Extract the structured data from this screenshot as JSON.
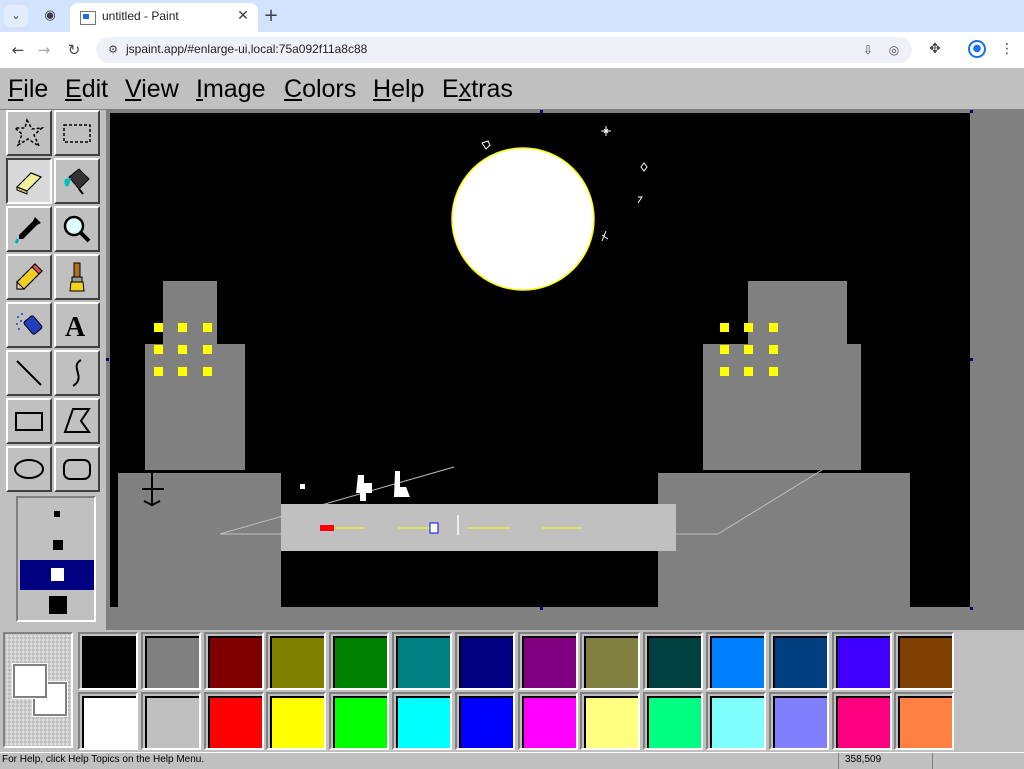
{
  "browser": {
    "tab_title": "untitled - Paint",
    "url": "jspaint.app/#enlarge-ui,local:75a092f11a8c88",
    "icons": {
      "tab_search": "chevron-down-icon",
      "inactive_tab": "chrome-logo-icon",
      "close": "close-icon",
      "new_tab": "plus-icon",
      "back": "back-arrow-icon",
      "forward": "forward-arrow-icon",
      "reload": "reload-icon",
      "site_info": "tune-icon",
      "install": "install-app-icon",
      "eye_off": "eye-off-icon",
      "extensions": "puzzle-icon",
      "profile": "profile-icon",
      "menu": "kebab-icon"
    }
  },
  "menu": {
    "file": "File",
    "edit": "Edit",
    "view": "View",
    "image": "Image",
    "colors": "Colors",
    "help": "Help",
    "extras": "Extras"
  },
  "tools": [
    {
      "id": "free-form-select",
      "icon": "free-form-select-icon",
      "pressed": false
    },
    {
      "id": "rect-select",
      "icon": "rectangular-select-icon",
      "pressed": false
    },
    {
      "id": "eraser",
      "icon": "eraser-icon",
      "pressed": true
    },
    {
      "id": "fill",
      "icon": "paint-bucket-icon",
      "pressed": false
    },
    {
      "id": "pick-color",
      "icon": "eyedropper-icon",
      "pressed": false
    },
    {
      "id": "magnifier",
      "icon": "magnifier-icon",
      "pressed": false
    },
    {
      "id": "pencil",
      "icon": "pencil-icon",
      "pressed": false
    },
    {
      "id": "brush",
      "icon": "brush-icon",
      "pressed": false
    },
    {
      "id": "airbrush",
      "icon": "airbrush-icon",
      "pressed": false
    },
    {
      "id": "text",
      "icon": "text-icon",
      "pressed": false
    },
    {
      "id": "line",
      "icon": "line-icon",
      "pressed": false
    },
    {
      "id": "curve",
      "icon": "curve-icon",
      "pressed": false
    },
    {
      "id": "rectangle",
      "icon": "rectangle-icon",
      "pressed": false
    },
    {
      "id": "polygon",
      "icon": "polygon-icon",
      "pressed": false
    },
    {
      "id": "ellipse",
      "icon": "ellipse-icon",
      "pressed": false
    },
    {
      "id": "rounded-rectangle",
      "icon": "rounded-rectangle-icon",
      "pressed": false
    }
  ],
  "tool_options": {
    "eraser_sizes": [
      "small",
      "medium",
      "large",
      "largest"
    ],
    "selected_index": 2
  },
  "colors": {
    "foreground": "#ffffff",
    "background": "#ffffff",
    "palette_top": [
      "#000000",
      "#808080",
      "#800000",
      "#808000",
      "#008000",
      "#008080",
      "#000080",
      "#800080",
      "#808040",
      "#004040",
      "#0080ff",
      "#004080",
      "#4000ff",
      "#804000"
    ],
    "palette_bottom": [
      "#ffffff",
      "#c0c0c0",
      "#ff0000",
      "#ffff00",
      "#00ff00",
      "#00ffff",
      "#0000ff",
      "#ff00ff",
      "#ffff80",
      "#00ff80",
      "#80ffff",
      "#8080ff",
      "#ff0080",
      "#ff8040"
    ],
    "sky": "#000000",
    "moon": "#ffffff",
    "moon_outline": "#ffff00",
    "building": "#808080",
    "window": "#ffff00",
    "road": "#c0c0c0",
    "lane_marking": "#ffff00"
  },
  "status": {
    "help_text": "For Help, click Help Topics on the Help Menu.",
    "coordinates": "358,509"
  }
}
